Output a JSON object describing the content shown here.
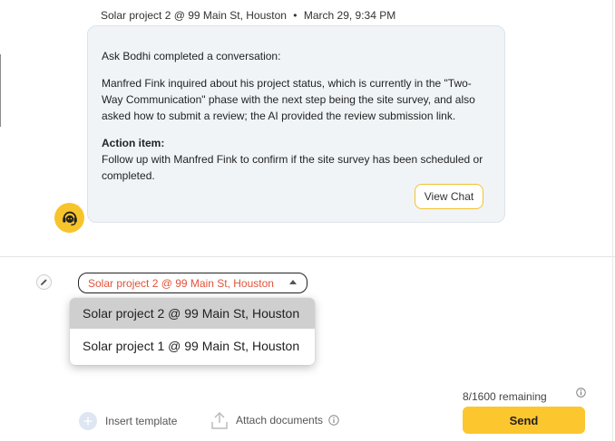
{
  "message": {
    "project": "Solar project 2 @ 99 Main St, Houston",
    "separator": "•",
    "timestamp": "March 29, 9:34 PM",
    "intro": "Ask Bodhi completed a conversation:",
    "summary": "Manfred Fink inquired about his project status, which is currently in the \"Two-Way Communication\" phase with the next step being the site survey, and also asked how to submit a review; the AI provided the review submission link.",
    "action_title": "Action item:",
    "action_text": "Follow up with Manfred Fink to confirm if the site survey has been scheduled or completed.",
    "view_chat_label": "View Chat"
  },
  "composer": {
    "selected_project": "Solar project 2 @ 99 Main St, Houston",
    "options": [
      "Solar project 2 @ 99 Main St, Houston",
      "Solar project 1 @ 99 Main St, Houston"
    ],
    "remaining": "8/1600 remaining",
    "insert_template_label": "Insert template",
    "attach_documents_label": "Attach documents",
    "send_label": "Send"
  },
  "colors": {
    "accent": "#fcc62f",
    "project_text": "#e0533b",
    "bubble_bg": "#f1f4f7"
  }
}
